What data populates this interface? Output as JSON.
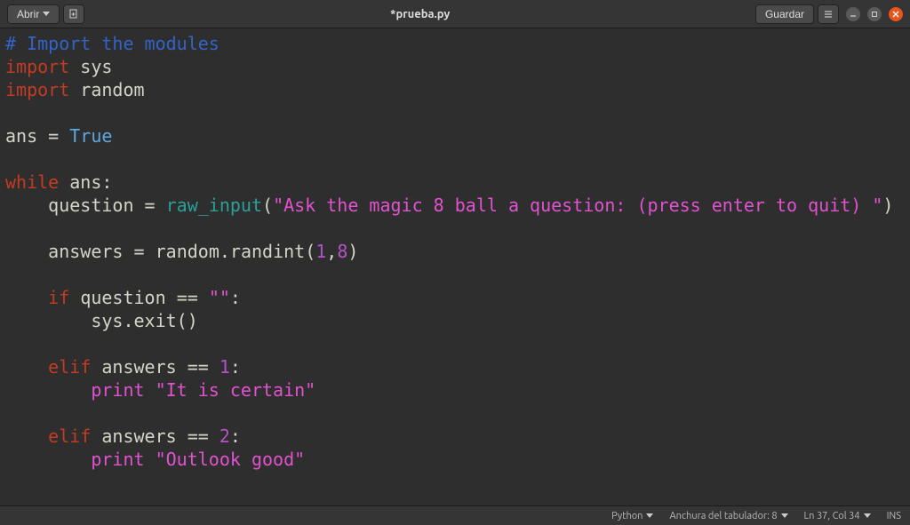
{
  "titlebar": {
    "open_label": "Abrir",
    "title": "*prueba.py",
    "save_label": "Guardar"
  },
  "code": {
    "comment1": "# Import the modules",
    "kw_import1": "import",
    "mod_sys": "sys",
    "kw_import2": "import",
    "mod_random": "random",
    "var_ans": "ans",
    "op_assign1": "=",
    "const_true": "True",
    "kw_while": "while",
    "var_ans2": "ans",
    "colon1": ":",
    "var_question": "question",
    "op_assign2": "=",
    "fn_rawinput": "raw_input",
    "paren_open1": "(",
    "str_prompt": "\"Ask the magic 8 ball a question: (press enter to quit) \"",
    "paren_close1": ")",
    "var_answers": "answers",
    "op_assign3": "=",
    "mod_random2": "random",
    "dot1": ".",
    "fn_randint": "randint",
    "paren_open2": "(",
    "num_1": "1",
    "comma1": ",",
    "num_8": "8",
    "paren_close2": ")",
    "kw_if": "if",
    "var_question2": "question",
    "op_eq1": "==",
    "str_empty": "\"\"",
    "colon2": ":",
    "mod_sys2": "sys",
    "dot2": ".",
    "fn_exit": "exit",
    "paren_open3": "(",
    "paren_close3": ")",
    "kw_elif1": "elif",
    "var_answers2": "answers",
    "op_eq2": "==",
    "num_1b": "1",
    "colon3": ":",
    "kw_print1": "print",
    "str_certain": "\"It is certain\"",
    "kw_elif2": "elif",
    "var_answers3": "answers",
    "op_eq3": "==",
    "num_2": "2",
    "colon4": ":",
    "kw_print2": "print",
    "str_outlook": "\"Outlook good\""
  },
  "statusbar": {
    "lang": "Python",
    "tab_width": "Anchura del tabulador: 8",
    "position": "Ln 37, Col 34",
    "mode": "INS"
  }
}
